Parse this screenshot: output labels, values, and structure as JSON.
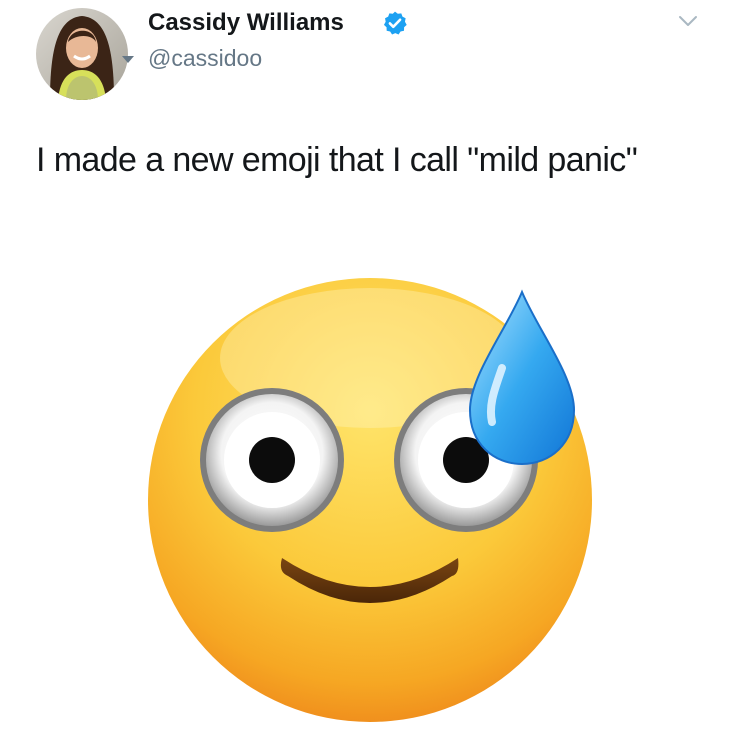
{
  "user": {
    "display_name": "Cassidy Williams",
    "handle": "@cassidoo",
    "verified": true
  },
  "tweet": {
    "text": "I made a new emoji that I call \"mild panic\""
  },
  "icons": {
    "verified": "verified-badge-icon",
    "menu": "chevron-down-icon",
    "emoji": "mild-panic-emoji"
  },
  "colors": {
    "verified": "#1da1f2",
    "name": "#14171a",
    "handle": "#657786"
  }
}
